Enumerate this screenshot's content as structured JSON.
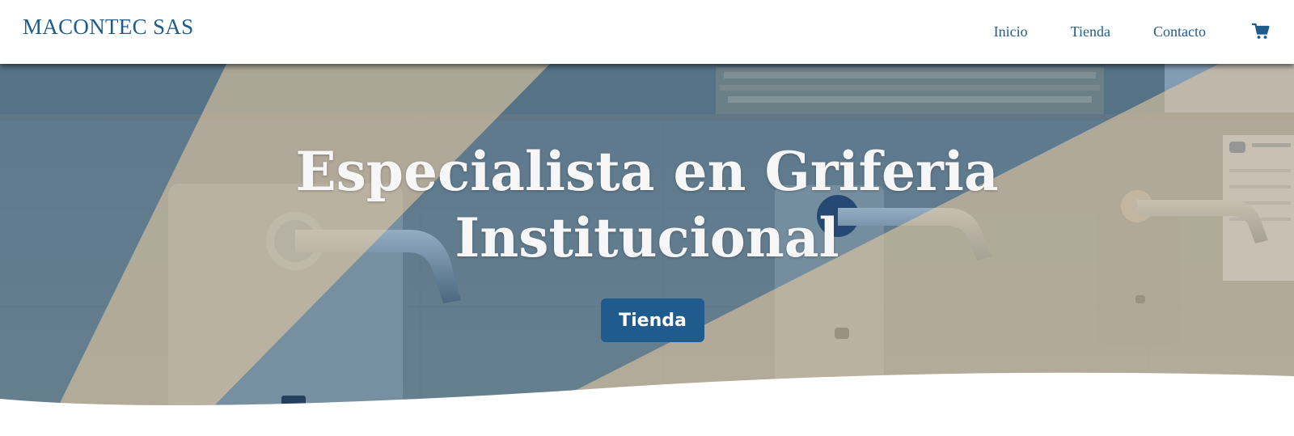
{
  "header": {
    "brand": "MACONTEC SAS",
    "nav": [
      {
        "label": "Inicio"
      },
      {
        "label": "Tienda"
      },
      {
        "label": "Contacto"
      }
    ],
    "cart_icon": "shopping-cart-icon"
  },
  "hero": {
    "title_line1": "Especialista en Griferia",
    "title_line2": "Institucional",
    "button_label": "Tienda"
  },
  "colors": {
    "brand": "#1f5b8c",
    "overlay_blue": "#1f5b8c",
    "overlay_tan": "#e9c8a2",
    "text_light": "#f6f6f6"
  }
}
